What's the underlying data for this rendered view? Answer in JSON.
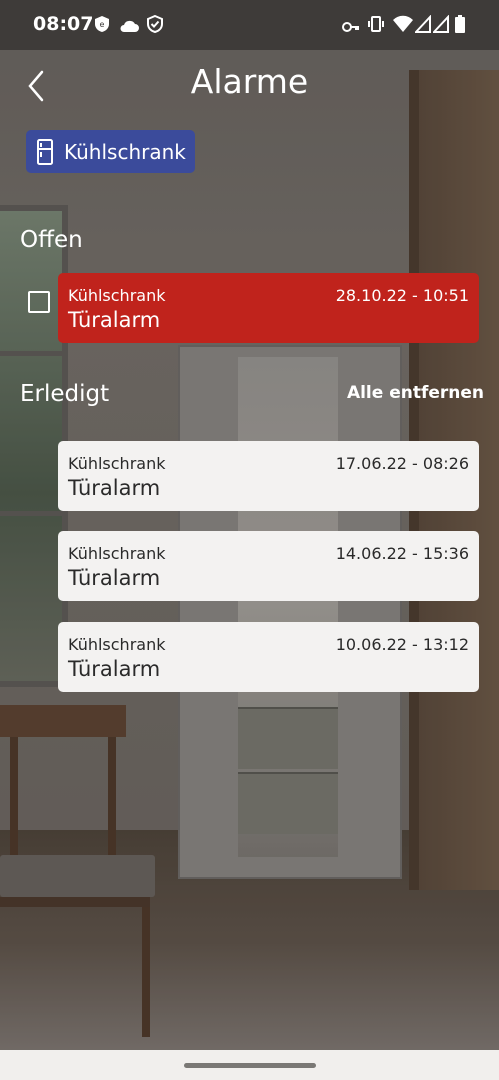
{
  "status_bar": {
    "time": "08:07",
    "left_icons": [
      "shield-badge-icon",
      "cloud-icon",
      "shield-check-icon"
    ],
    "right_icons": [
      "key-icon",
      "vibrate-icon",
      "wifi-icon",
      "signal-icon",
      "signal-icon",
      "battery-icon"
    ]
  },
  "header": {
    "title": "Alarme",
    "back_icon": "chevron-left-icon"
  },
  "filter_chip": {
    "icon": "fridge-icon",
    "label": "Kühlschrank",
    "color": "#3b4b9b"
  },
  "open_section": {
    "title": "Offen",
    "alarms": [
      {
        "device": "Kühlschrank",
        "date": "28.10.22 - 10:51",
        "name": "Türalarm",
        "color": "#c0231c",
        "checked": false
      }
    ]
  },
  "done_section": {
    "title": "Erledigt",
    "clear_all_label": "Alle entfernen",
    "alarms": [
      {
        "device": "Kühlschrank",
        "date": "17.06.22 - 08:26",
        "name": "Türalarm"
      },
      {
        "device": "Kühlschrank",
        "date": "14.06.22 - 15:36",
        "name": "Türalarm"
      },
      {
        "device": "Kühlschrank",
        "date": "10.06.22 - 13:12",
        "name": "Türalarm"
      }
    ]
  }
}
